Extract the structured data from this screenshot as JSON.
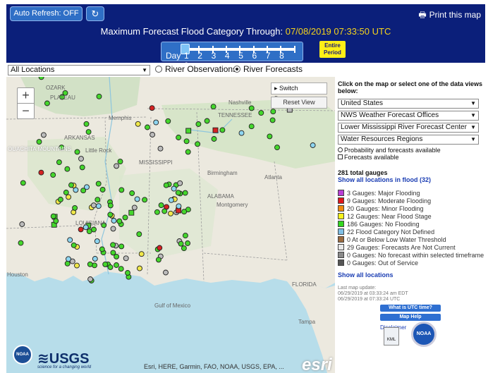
{
  "header": {
    "auto_refresh_label": "Auto Refresh: OFF",
    "refresh_icon": "refresh-icon",
    "print_label": "Print this map",
    "print_icon": "printer-icon",
    "title_prefix": "Maximum Forecast Flood Category Through:",
    "title_timestamp": "07/08/2019 07:33:50 UTC",
    "day_label": "Day",
    "day_numbers": [
      "1",
      "2",
      "3",
      "4",
      "5",
      "6",
      "7",
      "8",
      "9"
    ],
    "selected_day": 1,
    "entire_period_label": "Entire Period",
    "accent_color": "#f5d31c",
    "bar_color": "#0b1f7a"
  },
  "controls": {
    "location_value": "All Locations",
    "river_observations": "River Observations",
    "river_forecasts": "River Forecasts",
    "selected": "River Forecasts"
  },
  "map": {
    "zoom_in": "+",
    "zoom_out": "−",
    "switch_basemap": "Switch Basemap",
    "reset_view": "Reset View",
    "labels": [
      "OZARK",
      "PLATEAU",
      "Memphis",
      "Nashville",
      "TENNESSEE",
      "ARKANSAS",
      "OUACHITA MOUNTAINS",
      "Little Rock",
      "MISSISSIPPI",
      "Birmingham",
      "Atlanta",
      "ALABAMA",
      "Montgomery",
      "LOUISIANA",
      "Houston",
      "FLORIDA",
      "Tampa",
      "Gulf of Mexico"
    ],
    "attribution": "Esri, HERE, Garmin, FAO, NOAA, USGS, EPA, ...",
    "esri_logo": "esri",
    "noaa_logo": "NOAA",
    "usgs_logo": "USGS",
    "usgs_tagline": "science for a changing world",
    "gauges": [
      [
        7,
        "#44d62c"
      ],
      [
        14,
        "#f0e84a"
      ],
      [
        19,
        "#44d62c"
      ],
      [
        5,
        "#44d62c"
      ],
      [
        16,
        "#bbbbbb"
      ],
      [
        10,
        "#44d62c"
      ],
      [
        7,
        "#d42222"
      ],
      [
        11,
        "#44d62c"
      ],
      [
        16,
        "#8ed5f0"
      ],
      [
        3,
        "#44d62c"
      ],
      [
        15,
        "#44d62c"
      ],
      [
        28,
        "#44d62c"
      ],
      [
        4,
        "#bbbbbb"
      ]
    ]
  },
  "panel": {
    "instructions": "Click on the map or select one of the data views below:",
    "dropdowns": [
      "United States",
      "NWS Weather Forecast Offices",
      "Lower Mississippi River Forecast Center",
      "Water Resources Regions"
    ],
    "note_probability": "Probability and forecasts available",
    "note_forecasts": "Forecasts available",
    "total_gauges": "281 total gauges",
    "show_flood_link": "Show all locations in flood (32)",
    "legend": [
      {
        "label": "3 Gauges: Major Flooding",
        "color": "#b93fd6"
      },
      {
        "label": "9 Gauges: Moderate Flooding",
        "color": "#e0161c"
      },
      {
        "label": "20 Gauges: Minor Flooding",
        "color": "#f08a10"
      },
      {
        "label": "12 Gauges: Near Flood Stage",
        "color": "#f6f31c"
      },
      {
        "label": "186 Gauges: No Flooding",
        "color": "#33d61f"
      },
      {
        "label": "22 Flood Category Not Defined",
        "color": "#7fbfe6"
      },
      {
        "label": "0 At or Below Low Water Threshold",
        "color": "#9c6b3f"
      },
      {
        "label": "29 Gauges: Forecasts Are Not Current",
        "color": "#e8e8e8"
      },
      {
        "label": "0 Gauges: No forecast within selected timeframe",
        "color": "#8a8a8a"
      },
      {
        "label": "0 Gauges: Out of Service",
        "color": "#555555"
      }
    ],
    "show_all_link": "Show all locations",
    "last_update_label": "Last map update:",
    "update_edt": "06/29/2019 at 03:33:24 am EDT",
    "update_utc": "06/29/2019 at 07:33:24 UTC",
    "utc_button": "What is UTC time?",
    "help_button": "Map Help",
    "disclaimer": "Disclaimer",
    "kml_label": "KML",
    "noaa_label": "NOAA"
  }
}
